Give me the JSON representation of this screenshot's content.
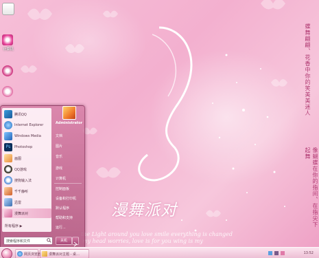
{
  "wallpaper": {
    "vertical_text_1": "蝶舞翩翩、花香中你的笑美美迷人",
    "vertical_text_2": "像蝴蝶在你的指间、在指尖下起舞",
    "art_title": "漫舞派对",
    "art_line_1": "the Light around you love smile everything is changed",
    "art_line_2": "my head worries, love is for you wing is my"
  },
  "desktop": {
    "icons": [
      {
        "name": "recycle-bin-icon",
        "label": ""
      },
      {
        "name": "home-icon",
        "label": "计算机"
      },
      {
        "name": "user-folder-icon",
        "label": ""
      },
      {
        "name": "network-icon",
        "label": ""
      }
    ]
  },
  "start_menu": {
    "programs": [
      {
        "label": "腾讯QQ",
        "icon": "qq-icon"
      },
      {
        "label": "Internet Explorer",
        "icon": "ie-icon"
      },
      {
        "label": "Windows Media",
        "icon": "media-icon"
      },
      {
        "label": "Photoshop",
        "icon": "ps-icon"
      },
      {
        "label": "画图",
        "icon": "paint-icon"
      },
      {
        "label": "QQ游戏",
        "icon": "penguin-icon"
      },
      {
        "label": "搜狗输入法",
        "icon": "sogou-icon"
      },
      {
        "label": "千千静听",
        "icon": "player-icon"
      },
      {
        "label": "迅雷",
        "icon": "thunder-icon"
      },
      {
        "label": "漫舞派对",
        "icon": "theme-icon"
      }
    ],
    "all_programs": "所有程序 ▶",
    "search_placeholder": "搜索程序和文件",
    "user_name": "Administrator",
    "right_items": [
      "文档",
      "图片",
      "音乐",
      "游戏",
      "计算机",
      "控制面板",
      "设备和打印机",
      "默认程序",
      "帮助和支持",
      "运行..."
    ],
    "shutdown_label": "关机"
  },
  "taskbar": {
    "buttons": [
      {
        "label": "网页浏览器",
        "icon": "ie-icon"
      },
      {
        "label": "漫舞派对主题 - 桌…",
        "icon": "folder-icon"
      }
    ],
    "clock": "13:52"
  },
  "colors": {
    "accent": "#c14f86",
    "text_vertical": "#b03a72"
  }
}
